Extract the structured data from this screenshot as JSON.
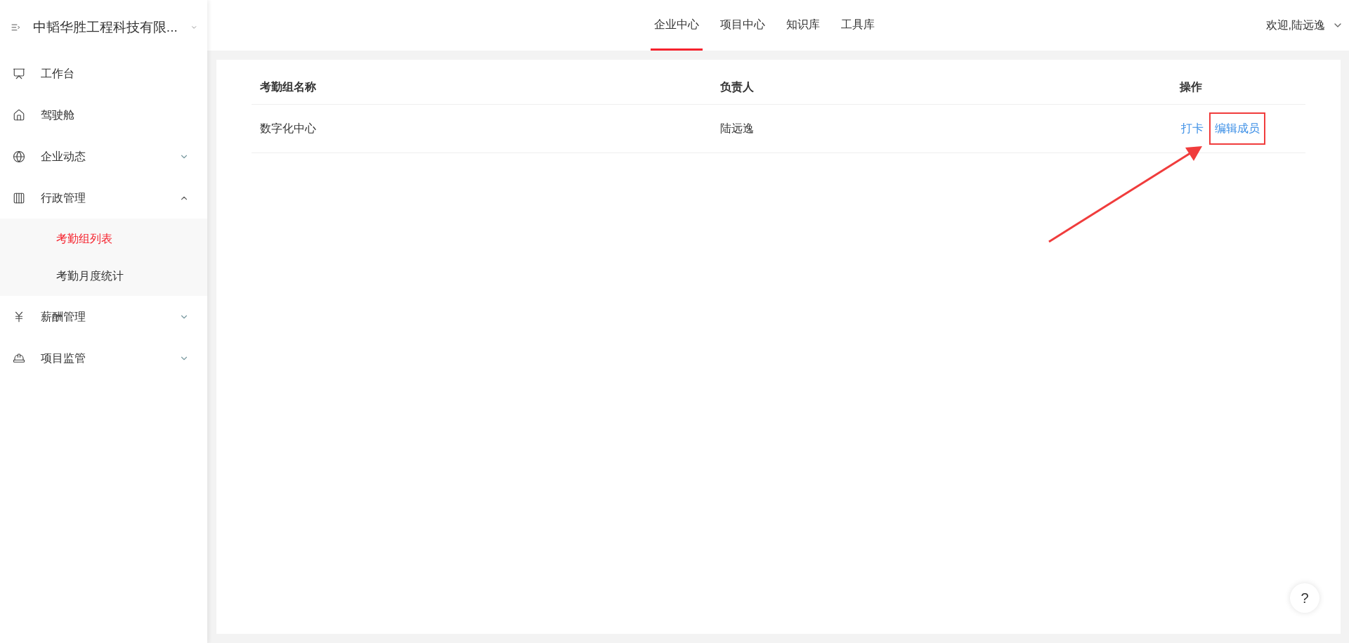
{
  "company": {
    "name": "中韬华胜工程科技有限..."
  },
  "sidebar": {
    "items": [
      {
        "label": "工作台",
        "kind": "link"
      },
      {
        "label": "驾驶舱",
        "kind": "link"
      },
      {
        "label": "企业动态",
        "kind": "group",
        "expanded": false
      },
      {
        "label": "行政管理",
        "kind": "group",
        "expanded": true,
        "children": [
          {
            "label": "考勤组列表",
            "selected": true
          },
          {
            "label": "考勤月度统计",
            "selected": false
          }
        ]
      },
      {
        "label": "薪酬管理",
        "kind": "group",
        "expanded": false
      },
      {
        "label": "项目监管",
        "kind": "group",
        "expanded": false
      }
    ]
  },
  "tabs": [
    {
      "label": "企业中心",
      "selected": true
    },
    {
      "label": "项目中心",
      "selected": false
    },
    {
      "label": "知识库",
      "selected": false
    },
    {
      "label": "工具库",
      "selected": false
    }
  ],
  "user": {
    "greeting": "欢迎,陆远逸"
  },
  "table": {
    "columns": [
      "考勤组名称",
      "负责人",
      "操作"
    ],
    "rows": [
      {
        "name": "数字化中心",
        "owner": "陆远逸",
        "actions": [
          {
            "label": "打卡",
            "highlighted": false
          },
          {
            "label": "编辑成员",
            "highlighted": true
          }
        ]
      }
    ]
  },
  "help": {
    "label": "?"
  }
}
